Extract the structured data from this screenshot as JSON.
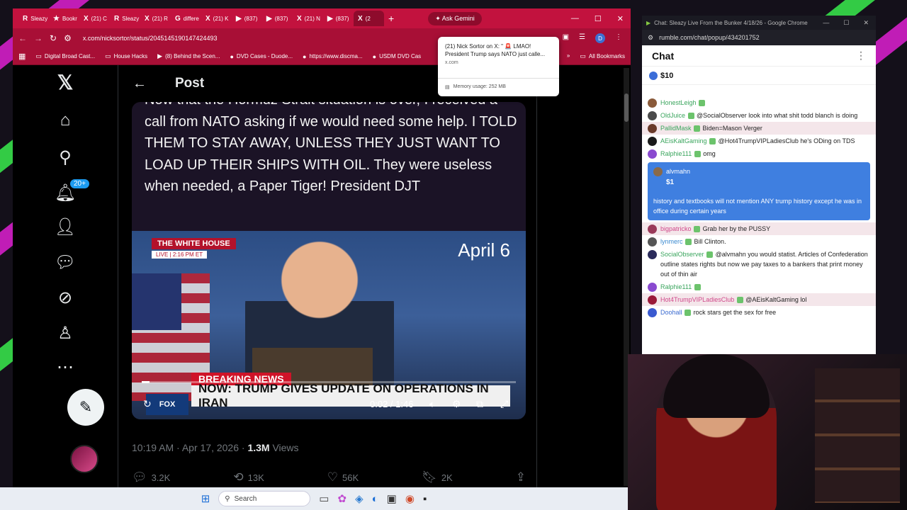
{
  "colors": {
    "chrome_accent": "#c2123e",
    "x_bg": "#000000",
    "x_blue": "#1d9bf0",
    "rumble_rant": "#3f7fe0"
  },
  "browser": {
    "tabs": [
      {
        "icon": "rumble-icon",
        "label": "Sleazy"
      },
      {
        "icon": "bookmark-star-icon",
        "label": "Bookr"
      },
      {
        "icon": "x-icon",
        "label": "(21) C"
      },
      {
        "icon": "rumble-icon",
        "label": "Sleazy"
      },
      {
        "icon": "x-icon",
        "label": "(21) R"
      },
      {
        "icon": "google-icon",
        "label": "differe"
      },
      {
        "icon": "x-icon",
        "label": "(21) K"
      },
      {
        "icon": "youtube-icon",
        "label": "(837)"
      },
      {
        "icon": "youtube-icon",
        "label": "(837)"
      },
      {
        "icon": "x-icon",
        "label": "(21) N"
      },
      {
        "icon": "youtube-icon",
        "label": "(837)"
      },
      {
        "icon": "x-icon",
        "label": "(2"
      }
    ],
    "new_tab": "+",
    "gemini": "Ask Gemini",
    "url": "x.com/nicksortor/status/2045145190147424493",
    "bookmarks": [
      {
        "icon": "folder-icon",
        "label": "Digital Broad Cast..."
      },
      {
        "icon": "folder-icon",
        "label": "House Hacks"
      },
      {
        "icon": "youtube-icon",
        "label": "(8) Behind the Scen..."
      },
      {
        "icon": "dvd-icon",
        "label": "DVD Cases - Duode..."
      },
      {
        "icon": "web-icon",
        "label": "https://www.discma..."
      },
      {
        "icon": "usdm-icon",
        "label": "USDM DVD Cas"
      }
    ],
    "bookmarks_more": "»",
    "all_bookmarks": "All Bookmarks",
    "hovercard": {
      "title": "(21) Nick Sortor on X: \" 🚨 LMAO! President Trump says NATO just calle...",
      "domain": "x.com",
      "memory": "Memory usage: 252 MB"
    }
  },
  "x": {
    "header_title": "Post",
    "notif_count": "20+",
    "post_text": "Now that the Hormuz Strait situation is over, I received a call from NATO asking if we would need some help. I TOLD THEM TO STAY AWAY, UNLESS THEY JUST WANT TO LOAD UP THEIR SHIPS WITH OIL. They were useless when needed, a Paper Tiger! President DJT",
    "video": {
      "wh_badge": "THE WHITE HOUSE",
      "wh_live": "LIVE | 2:16 PM ET",
      "date": "April 6",
      "breaking": "BREAKING NEWS",
      "headline": "NOW: TRUMP GIVES UPDATE ON OPERATIONS IN IRAN",
      "network": "FOX",
      "time": "0:02 / 1:46",
      "progress": 0.02
    },
    "meta_time": "10:19 AM · Apr 17, 2026 · ",
    "views_count": "1.3M",
    "views_label": " Views",
    "replies": "3.2K",
    "reposts": "13K",
    "likes": "56K",
    "bookmarks": "2K"
  },
  "chat": {
    "window_title": "Chat: Sleazy Live From the Bunker 4/18/26 - Google Chrome",
    "url": "rumble.com/chat/popup/434201752",
    "title": "Chat",
    "top_rant": "$10",
    "messages": [
      {
        "user": "HonestLeigh",
        "color": "#3aa55d",
        "text": "",
        "av": "#8a5a3a"
      },
      {
        "user": "OldJuice",
        "color": "#3aa55d",
        "text": "@SocialObserver look into what shit todd blanch is doing",
        "av": "#4a4a4a"
      },
      {
        "user": "PallidMask",
        "color": "#3aa55d",
        "text": "Biden=Mason Verger",
        "av": "#6a3a2a",
        "hl": true
      },
      {
        "user": "AEisKaltGaming",
        "color": "#3aa55d",
        "text": "@Hot4TrumpVIPLadiesClub he's ODing on TDS",
        "av": "#1a1a1a"
      },
      {
        "user": "Ralphie111",
        "color": "#3aa55d",
        "text": "omg",
        "av": "#8a4ad0"
      }
    ],
    "rant": {
      "user": "alvmahn",
      "amount": "$1",
      "text": "history and textbooks will not mention ANY trump history except he was in office during certain years"
    },
    "messages2": [
      {
        "user": "bigpatricko",
        "color": "#d0488a",
        "text": "Grab her by the PUSSY",
        "av": "#9a3a5a",
        "hl": true
      },
      {
        "user": "lynmerc",
        "color": "#3a8ad0",
        "text": "Bill Clinton.",
        "av": "#555"
      },
      {
        "user": "SocialObserver",
        "color": "#3aa55d",
        "text": "@alvmahn you would statist. Articles of Confederation outline states rights but now we pay taxes to a bankers that print money out of thin air",
        "av": "#2a2a5a"
      },
      {
        "user": "Ralphie111",
        "color": "#3aa55d",
        "text": "",
        "av": "#8a4ad0"
      },
      {
        "user": "Hot4TrumpVIPLadiesClub",
        "color": "#d0488a",
        "text": "@AEisKaltGaming lol",
        "av": "#9a1a3a",
        "hl": true
      },
      {
        "user": "Doohall",
        "color": "#3a6ad0",
        "text": "rock stars get the sex for free",
        "av": "#3a5ad0"
      }
    ]
  },
  "taskbar": {
    "search": "Search"
  }
}
